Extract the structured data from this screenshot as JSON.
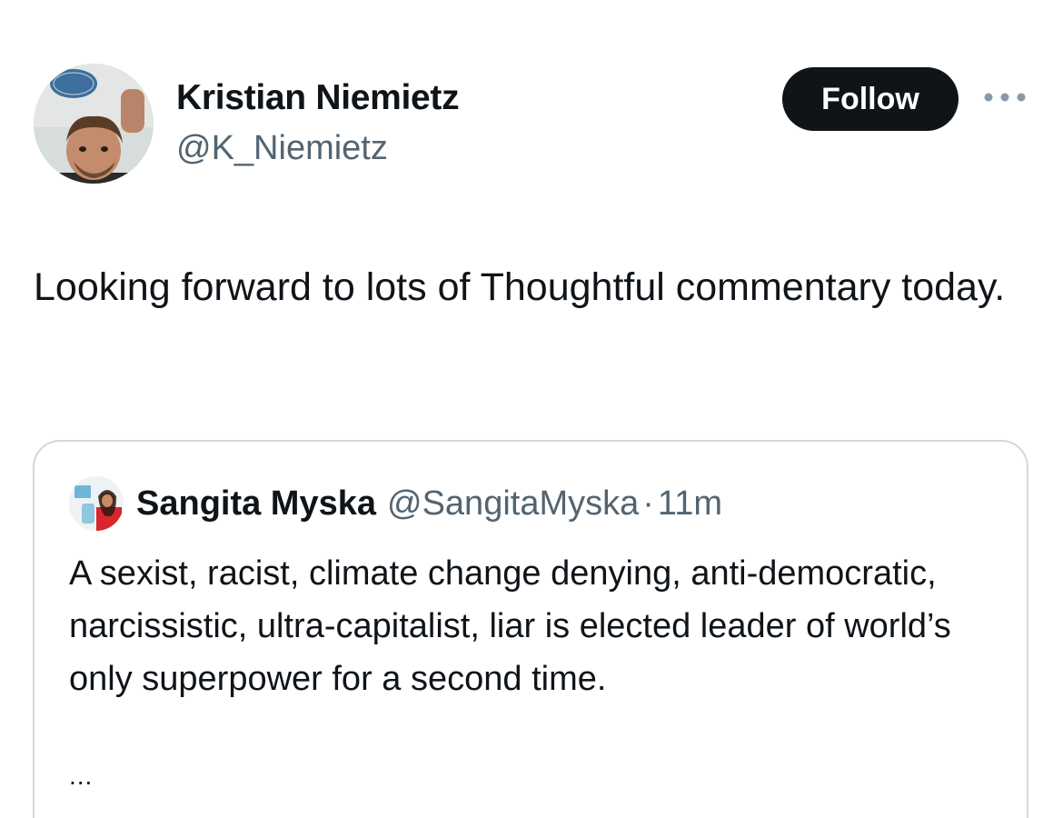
{
  "author": {
    "display_name": "Kristian Niemietz",
    "handle": "@K_Niemietz"
  },
  "actions": {
    "follow_label": "Follow",
    "more_icon": "more-horizontal-icon"
  },
  "tweet": {
    "text": "Looking forward to lots of Thoughtful commentary today."
  },
  "quoted_tweet": {
    "display_name": "Sangita Myska",
    "handle": "@SangitaMyska",
    "separator": "·",
    "time": "11m",
    "text": "A sexist, racist, climate change denying, anti-democratic, narcissistic, ultra-capitalist, liar is elected leader of world’s only superpower for a second time.",
    "truncation": "..."
  },
  "colors": {
    "text_primary": "#0f1419",
    "text_secondary": "#536471",
    "border": "#cfd9de",
    "button_bg": "#0f1419",
    "button_text": "#ffffff"
  }
}
